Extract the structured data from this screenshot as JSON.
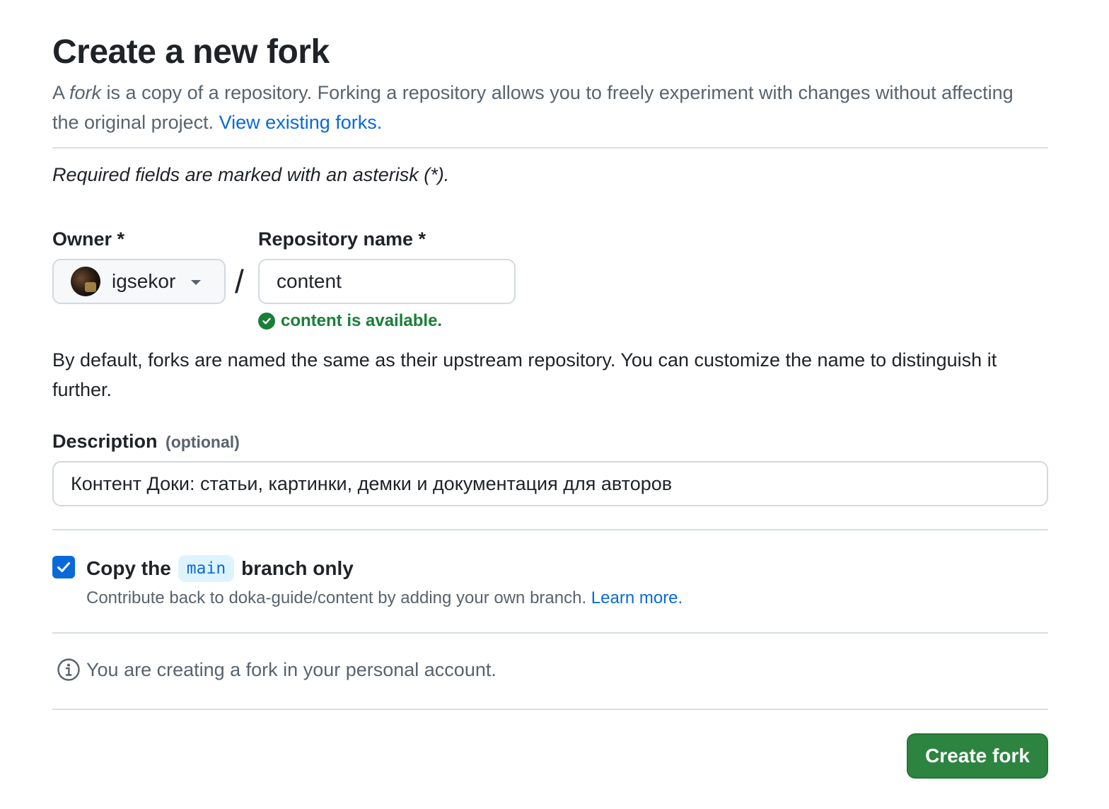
{
  "header": {
    "title": "Create a new fork",
    "intro_prefix": "A ",
    "intro_em": "fork",
    "intro_rest": " is a copy of a repository. Forking a repository allows you to freely experiment with changes without affecting the original project. ",
    "view_forks_link": "View existing forks."
  },
  "form": {
    "required_note": "Required fields are marked with an asterisk (*).",
    "owner": {
      "label": "Owner *",
      "value": "igsekor"
    },
    "separator": "/",
    "repository": {
      "label": "Repository name *",
      "value": "content",
      "availability": "content is available."
    },
    "default_note": "By default, forks are named the same as their upstream repository. You can customize the name to distinguish it further.",
    "description": {
      "label": "Description",
      "optional": "(optional)",
      "value": "Контент Доки: статьи, картинки, демки и документация для авторов"
    },
    "copy_branch": {
      "checked": true,
      "label_prefix": "Copy the",
      "branch": "main",
      "label_suffix": "branch only",
      "sub_text": "Contribute back to doka-guide/content by adding your own branch. ",
      "learn_more": "Learn more."
    },
    "info": "You are creating a fork in your personal account.",
    "submit_label": "Create fork"
  },
  "colors": {
    "link": "#0969da",
    "success": "#1a7f37",
    "primary_button": "#2c8440",
    "muted_text": "#59636e"
  },
  "icons": {
    "owner_avatar": "avatar",
    "owner_dropdown": "caret-down-icon",
    "availability": "check-circle-icon",
    "checkbox": "checkmark-icon",
    "info": "info-icon"
  }
}
